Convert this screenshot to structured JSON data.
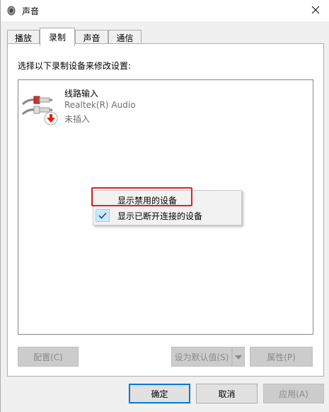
{
  "window": {
    "title": "声音",
    "icon": "speaker-icon",
    "close_icon": "close-icon"
  },
  "tabs": [
    {
      "label": "播放",
      "active": false
    },
    {
      "label": "录制",
      "active": true
    },
    {
      "label": "声音",
      "active": false
    },
    {
      "label": "通信",
      "active": false
    }
  ],
  "panel": {
    "instruction": "选择以下录制设备来修改设置:",
    "devices": [
      {
        "name": "线路输入",
        "driver": "Realtek(R) Audio",
        "status": "未插入",
        "icon": "line-in-jack-icon",
        "status_icon": "unplugged-arrow-icon"
      }
    ]
  },
  "context_menu": {
    "items": [
      {
        "label": "显示禁用的设备",
        "checked": false,
        "highlighted": true
      },
      {
        "label": "显示已断开连接的设备",
        "checked": true,
        "highlighted": false
      }
    ]
  },
  "buttons": {
    "configure": "配置(C)",
    "set_default": "设为默认值(S)",
    "properties": "属性(P)",
    "ok": "确定",
    "cancel": "取消",
    "apply": "应用(A)"
  },
  "colors": {
    "accent": "#0078d7",
    "highlight_border": "#e0202a",
    "checked_bg": "#cce8ff"
  }
}
